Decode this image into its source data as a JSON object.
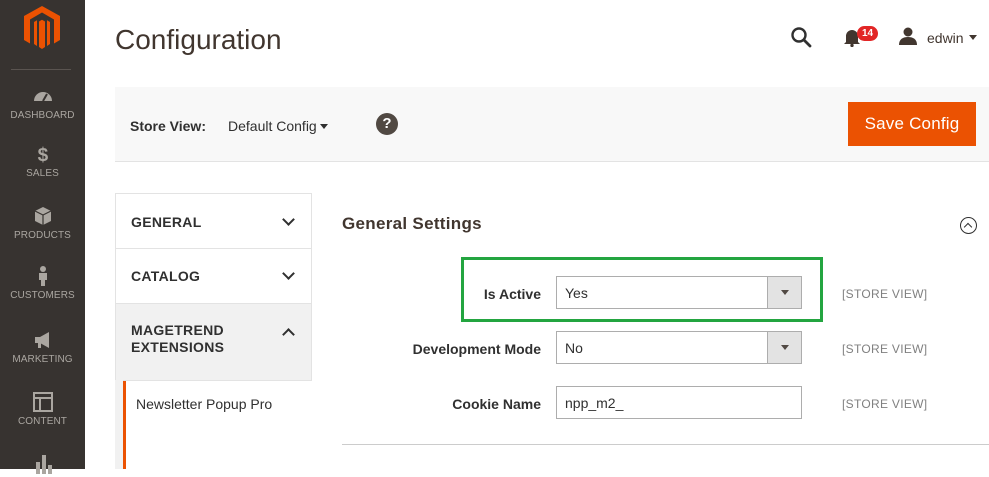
{
  "header": {
    "title": "Configuration",
    "notifications_count": "14",
    "user_name": "edwin"
  },
  "nav": {
    "items": [
      {
        "label": "DASHBOARD",
        "icon": "dashboard-icon"
      },
      {
        "label": "SALES",
        "icon": "dollar-icon"
      },
      {
        "label": "PRODUCTS",
        "icon": "box-icon"
      },
      {
        "label": "CUSTOMERS",
        "icon": "person-icon"
      },
      {
        "label": "MARKETING",
        "icon": "megaphone-icon"
      },
      {
        "label": "CONTENT",
        "icon": "layout-icon"
      }
    ]
  },
  "store_bar": {
    "label": "Store View:",
    "value": "Default Config",
    "save_label": "Save Config"
  },
  "tabs": {
    "general": "GENERAL",
    "catalog": "CATALOG",
    "magetrend": "MAGETREND EXTENSIONS",
    "subtab": "Newsletter Popup Pro"
  },
  "section": {
    "title": "General Settings",
    "fields": [
      {
        "label": "Is Active",
        "value": "Yes",
        "scope": "[STORE VIEW]"
      },
      {
        "label": "Development Mode",
        "value": "No",
        "scope": "[STORE VIEW]"
      },
      {
        "label": "Cookie Name",
        "value": "npp_m2_",
        "scope": "[STORE VIEW]"
      }
    ]
  },
  "colors": {
    "accent": "#eb5202",
    "sidebar": "#373330",
    "highlight": "#23a540"
  }
}
